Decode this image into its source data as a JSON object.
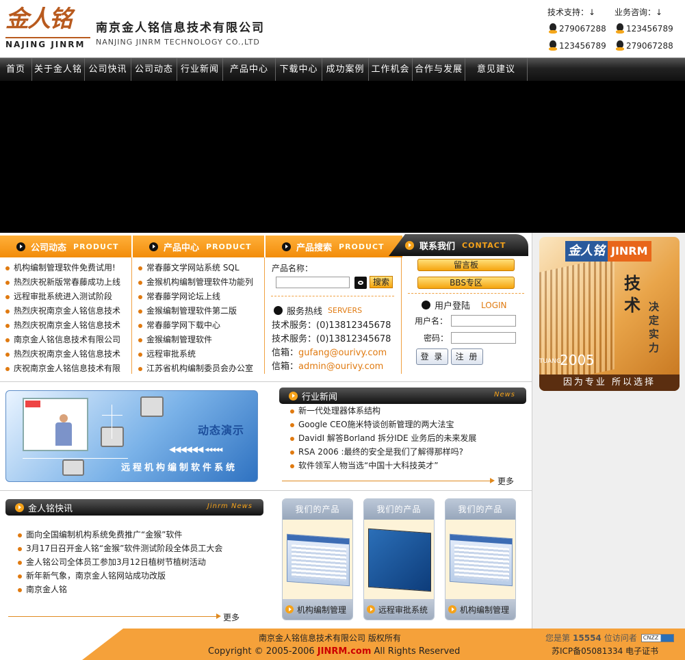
{
  "header": {
    "logo_cn": "金人铭",
    "logo_en": "NAJING JINRM",
    "company_cn": "南京金人铭信息技术有限公司",
    "company_en": "NANJING JINRM TECHNOLOGY CO.,LTD",
    "support_label": "技术支持：↓",
    "business_label": "业务咨询：↓",
    "qq": [
      "279067288",
      "123456789",
      "123456789",
      "279067288"
    ]
  },
  "nav": [
    "首页",
    "关于金人铭",
    "公司快讯",
    "公司动态",
    "行业新闻",
    "产品中心",
    "下载中心",
    "成功案例",
    "工作机会",
    "合作与发展",
    "意见建议"
  ],
  "sections": {
    "news": {
      "title": "公司动态",
      "en": "PRODUCT"
    },
    "products": {
      "title": "产品中心",
      "en": "PRODUCT"
    },
    "search": {
      "title": "产品搜索",
      "en": "PRODUCT"
    },
    "contact": {
      "title": "联系我们",
      "en": "CONTACT"
    }
  },
  "company_news": [
    "机构编制管理软件免费试用!",
    "热烈庆祝新版常春藤成功上线",
    "远程审批系统进入测试阶段",
    "热烈庆祝南京金人铭信息技术",
    "热烈庆祝南京金人铭信息技术",
    "南京金人铭信息技术有限公司",
    "热烈庆祝南京金人铭信息技术",
    "庆祝南京金人铭信息技术有限"
  ],
  "product_list": [
    "常春藤文学网站系统 SQL",
    "金猴机构编制管理软件功能列",
    "常春藤学网论坛上线",
    "金猴编制管理软件第二版",
    "常春藤学网下载中心",
    "金猴编制管理软件",
    "远程审批系统",
    "江苏省机构编制委员会办公室"
  ],
  "search": {
    "label": "产品名称：",
    "value": "",
    "button": "搜索",
    "hotline_title": "服务热线",
    "hotline_en": "SERVERS",
    "lines": [
      {
        "label": "技术服务：",
        "value": "(0)13812345678"
      },
      {
        "label": "技术服务：",
        "value": "(0)13812345678"
      },
      {
        "label": "信箱：",
        "value": "gufang@ourivy.com"
      },
      {
        "label": "信箱：",
        "value": "admin@ourivy.com"
      }
    ]
  },
  "contact": {
    "guestbook": "留言板",
    "bbs": "BBS专区",
    "login_title": "用户登陆",
    "login_en": "LOGIN",
    "username_label": "用户名：",
    "password_label": "密码：",
    "username_value": "",
    "password_value": "",
    "login_button": "登 录",
    "register_button": "注 册"
  },
  "ad": {
    "logo_a": "金人铭",
    "logo_b": "JINRM",
    "big": "技术",
    "small": "决定实力",
    "year": "2005",
    "year_prefix": "TUANG",
    "slogan": "因为专业  所以选择"
  },
  "demo": {
    "title": "动态演示",
    "subtitle": "远程机构编制软件系统"
  },
  "industry_news": {
    "title": "行业新闻",
    "tag": "News",
    "items": [
      "新一代处理器体系结构",
      "Google CEO施米特谈创新管理的两大法宝",
      "DavidI 解答Borland 拆分IDE 业务后的未来发展",
      "RSA 2006 :最终的安全是我们了解得那样吗?",
      "软件领军人物当选“中国十大科技英才”"
    ],
    "more": "更多"
  },
  "flash": {
    "title": "金人铭快讯",
    "tag": "Jinrm News",
    "items": [
      "面向全国编制机构系统免费推广“金猴”软件",
      "3月17日召开金人铭“金猴”软件测试阶段全体员工大会",
      "金人铭公司全体员工参加3月12日植树节植树活动",
      "新年新气象，南京金人铭网站成功改版",
      "南京金人铭"
    ],
    "more": "更多"
  },
  "our_products": [
    {
      "header": "我们的产品",
      "name": "机构编制管理"
    },
    {
      "header": "我们的产品",
      "name": "远程审批系统"
    },
    {
      "header": "我们的产品",
      "name": "机构编制管理"
    }
  ],
  "footer": {
    "line1": "南京金人铭信息技术有限公司 版权所有",
    "copyright_pre": "Copyright © 2005-2006 ",
    "brand": "JINRM.com",
    "copyright_post": " All Rights Reserved",
    "visit_pre": "您是第",
    "visit_count": "15554",
    "visit_post": "位访问者",
    "cnzz": "CNZZ",
    "icp": "苏ICP备05081334  电子证书"
  }
}
